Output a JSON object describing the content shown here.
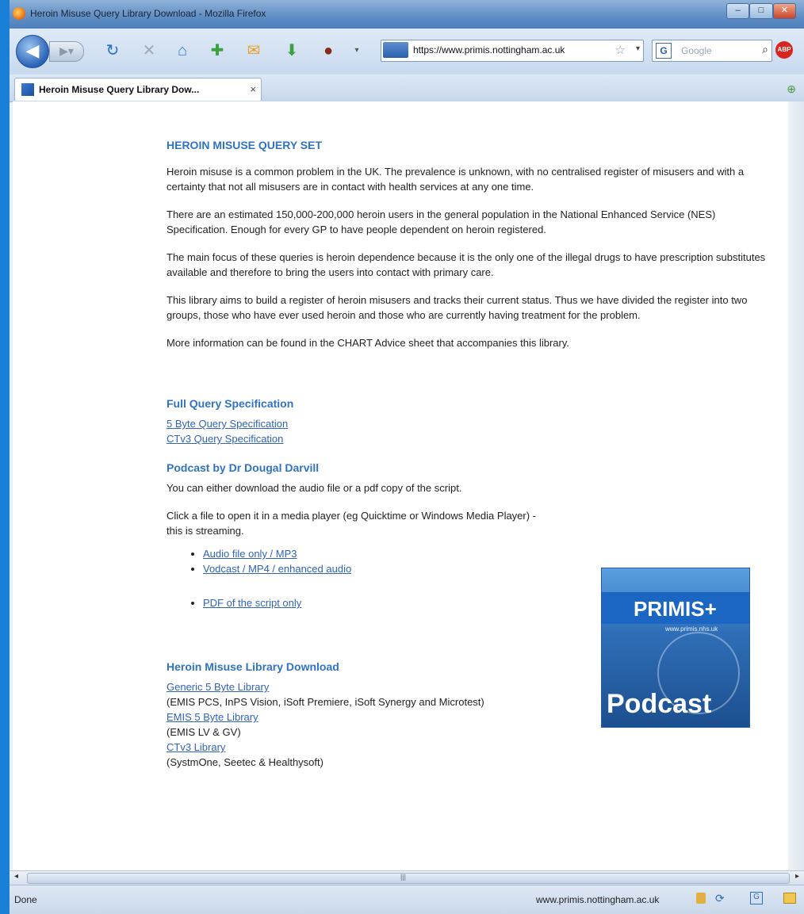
{
  "window": {
    "title": "Heroin Misuse Query Library Download - Mozilla Firefox"
  },
  "toolbar": {
    "url": "https://www.primis.nottingham.ac.uk",
    "search_placeholder": "Google"
  },
  "tab": {
    "label": "Heroin Misuse Query Library Dow...",
    "close": "×"
  },
  "page": {
    "title": "HEROIN MISUSE QUERY SET",
    "paragraphs": [
      "Heroin misuse is a common problem in the UK. The prevalence is unknown, with no centralised register of misusers and with a certainty that not all misusers are in contact with health services at any one time.",
      "There are an estimated 150,000-200,000 heroin users in the general population in the National Enhanced Service (NES) Specification. Enough for every GP to have people dependent on heroin registered.",
      "The main focus of these queries is heroin dependence because it is the only one of the illegal drugs to have prescription substitutes available and therefore to bring the users into contact with primary care.",
      "This library aims to build a register of heroin misusers and tracks their current status. Thus we have divided the register into two groups, those who have ever used heroin and those who are currently having treatment for the problem.",
      "More information can be found in the CHART Advice sheet that accompanies this library."
    ],
    "spec": {
      "heading": "Full Query Specification",
      "links": [
        "5 Byte Query Specification",
        "CTv3 Query Specification"
      ]
    },
    "podcast": {
      "heading": "Podcast by Dr Dougal Darvill",
      "intro": "You can either download the audio file or a pdf copy of the script.",
      "instructions": "Click a file to open it in a media player (eg Quicktime or Windows Media Player) - this is streaming.",
      "links": [
        "Audio file only / MP3",
        "Vodcast / MP4 / enhanced audio",
        "PDF of the script only"
      ],
      "image_brand": "PRIMIS+",
      "image_url_text": "www.primis.nhs.uk",
      "image_label": "Podcast"
    },
    "download": {
      "heading": "Heroin Misuse Library Download",
      "items": [
        {
          "link": "Generic 5 Byte Library",
          "desc": "(EMIS PCS, InPS Vision, iSoft Premiere, iSoft Synergy and Microtest)"
        },
        {
          "link": "EMIS 5 Byte Library",
          "desc": "(EMIS LV & GV)"
        },
        {
          "link": "CTv3 Library",
          "desc": "(SystmOne, Seetec & Healthysoft)"
        }
      ]
    }
  },
  "statusbar": {
    "status": "Done",
    "host": "www.primis.nottingham.ac.uk"
  }
}
